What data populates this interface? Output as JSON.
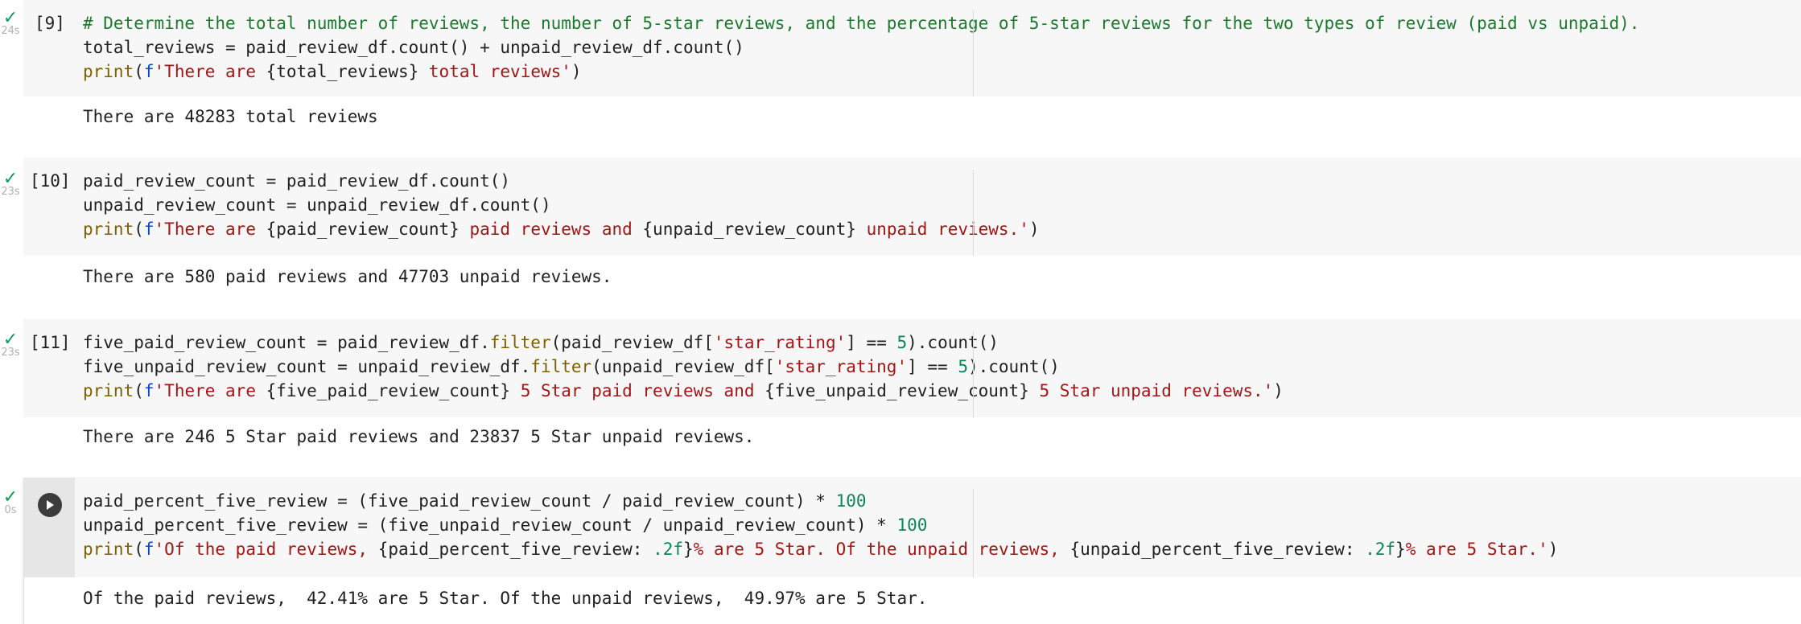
{
  "cells": [
    {
      "exec_count": "[9]",
      "status_icon": "check-icon",
      "status_glyph": "✓",
      "duration": "24s",
      "code": [
        [
          {
            "t": "cm",
            "v": "# Determine the total number of reviews, the number of 5-star reviews, and the percentage of 5-star reviews for the two types of review (paid vs unpaid)."
          }
        ],
        [
          {
            "t": "",
            "v": "total_reviews = paid_review_df.count() + unpaid_review_df.count()"
          }
        ],
        [
          {
            "t": "kw",
            "v": "print"
          },
          {
            "t": "",
            "v": "("
          },
          {
            "t": "fs",
            "v": "f"
          },
          {
            "t": "st",
            "v": "'There are "
          },
          {
            "t": "",
            "v": "{total_reviews}"
          },
          {
            "t": "st",
            "v": " total reviews'"
          },
          {
            "t": "",
            "v": ")"
          }
        ]
      ],
      "output": "There are 48283 total reviews"
    },
    {
      "exec_count": "[10]",
      "status_icon": "check-icon",
      "status_glyph": "✓",
      "duration": "23s",
      "code": [
        [
          {
            "t": "",
            "v": "paid_review_count = paid_review_df.count()"
          }
        ],
        [
          {
            "t": "",
            "v": "unpaid_review_count = unpaid_review_df.count()"
          }
        ],
        [
          {
            "t": "kw",
            "v": "print"
          },
          {
            "t": "",
            "v": "("
          },
          {
            "t": "fs",
            "v": "f"
          },
          {
            "t": "st",
            "v": "'There are "
          },
          {
            "t": "",
            "v": "{paid_review_count}"
          },
          {
            "t": "st",
            "v": " paid reviews and "
          },
          {
            "t": "",
            "v": "{unpaid_review_count}"
          },
          {
            "t": "st",
            "v": " unpaid reviews.'"
          },
          {
            "t": "",
            "v": ")"
          }
        ]
      ],
      "output": "There are 580 paid reviews and 47703 unpaid reviews."
    },
    {
      "exec_count": "[11]",
      "status_icon": "check-icon",
      "status_glyph": "✓",
      "duration": "23s",
      "code": [
        [
          {
            "t": "",
            "v": "five_paid_review_count = paid_review_df."
          },
          {
            "t": "kw",
            "v": "filter"
          },
          {
            "t": "",
            "v": "(paid_review_df["
          },
          {
            "t": "st",
            "v": "'star_rating'"
          },
          {
            "t": "",
            "v": "] == "
          },
          {
            "t": "nm",
            "v": "5"
          },
          {
            "t": "",
            "v": ").count()"
          }
        ],
        [
          {
            "t": "",
            "v": "five_unpaid_review_count = unpaid_review_df."
          },
          {
            "t": "kw",
            "v": "filter"
          },
          {
            "t": "",
            "v": "(unpaid_review_df["
          },
          {
            "t": "st",
            "v": "'star_rating'"
          },
          {
            "t": "",
            "v": "] == "
          },
          {
            "t": "nm",
            "v": "5"
          },
          {
            "t": "",
            "v": ").count()"
          }
        ],
        [
          {
            "t": "kw",
            "v": "print"
          },
          {
            "t": "",
            "v": "("
          },
          {
            "t": "fs",
            "v": "f"
          },
          {
            "t": "st",
            "v": "'There are "
          },
          {
            "t": "",
            "v": "{five_paid_review_count}"
          },
          {
            "t": "st",
            "v": " 5 Star paid reviews and "
          },
          {
            "t": "",
            "v": "{five_unpaid_review_count}"
          },
          {
            "t": "st",
            "v": " 5 Star unpaid reviews.'"
          },
          {
            "t": "",
            "v": ")"
          }
        ]
      ],
      "output": "There are 246 5 Star paid reviews and 23837 5 Star unpaid reviews."
    },
    {
      "exec_count": "",
      "status_icon": "check-icon",
      "status_glyph": "✓",
      "duration": "0s",
      "run_icon": "play-icon",
      "code": [
        [
          {
            "t": "",
            "v": "paid_percent_five_review = (five_paid_review_count / paid_review_count) * "
          },
          {
            "t": "nm",
            "v": "100"
          }
        ],
        [
          {
            "t": "",
            "v": "unpaid_percent_five_review = (five_unpaid_review_count / unpaid_review_count) * "
          },
          {
            "t": "nm",
            "v": "100"
          }
        ],
        [
          {
            "t": "kw",
            "v": "print"
          },
          {
            "t": "",
            "v": "("
          },
          {
            "t": "fs",
            "v": "f"
          },
          {
            "t": "st",
            "v": "'Of the paid reviews, "
          },
          {
            "t": "",
            "v": "{paid_percent_five_review: "
          },
          {
            "t": "nm",
            "v": ".2f"
          },
          {
            "t": "",
            "v": "}"
          },
          {
            "t": "st",
            "v": "% are 5 Star. Of the unpaid reviews, "
          },
          {
            "t": "",
            "v": "{unpaid_percent_five_review: "
          },
          {
            "t": "nm",
            "v": ".2f"
          },
          {
            "t": "",
            "v": "}"
          },
          {
            "t": "st",
            "v": "% are 5 Star.'"
          },
          {
            "t": "",
            "v": ")"
          }
        ]
      ],
      "output": "Of the paid reviews,  42.41% are 5 Star. Of the unpaid reviews,  49.97% are 5 Star."
    }
  ]
}
